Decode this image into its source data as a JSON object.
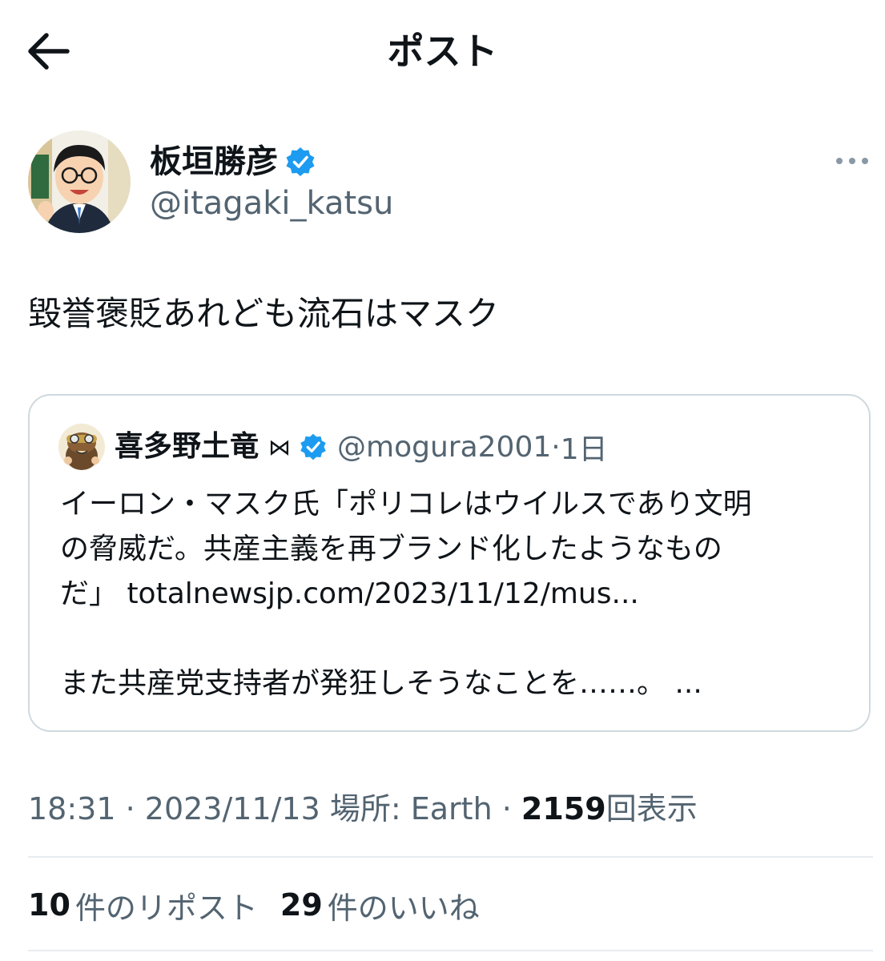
{
  "header": {
    "title": "ポスト",
    "back_icon": "arrow-left-icon"
  },
  "author": {
    "name": "板垣勝彦",
    "handle": "@itagaki_katsu",
    "verified_icon": "verified-badge-icon",
    "more_icon": "more-horizontal-icon"
  },
  "tweet": {
    "text": "毀誉褒貶あれども流石はマスク"
  },
  "quote": {
    "name": "喜多野土竜",
    "emoji": "⋈",
    "handle": "@mogura2001",
    "separator": "·",
    "time": "1日",
    "lines": [
      "イーロン・マスク氏「ポリコレはウイルスであり文明",
      "の脅威だ。共産主義を再ブランド化したようなもの",
      "だ」 totalnewsjp.com/2023/11/12/mus..."
    ],
    "last_line": "また共産党支持者が発狂しそうなことを……。 ..."
  },
  "meta": {
    "time": "18:31",
    "sep1": " · ",
    "date": "2023/11/13",
    "location": " 場所: Earth",
    "sep2": " · ",
    "views_count": "2159",
    "views_label": "回表示"
  },
  "stats": {
    "reposts_count": "10",
    "reposts_label": "件のリポスト",
    "likes_count": "29",
    "likes_label": "件のいいね"
  },
  "colors": {
    "text": "#0f1419",
    "secondary": "#536471",
    "verified": "#1d9bf0",
    "border": "#cfd9de"
  }
}
